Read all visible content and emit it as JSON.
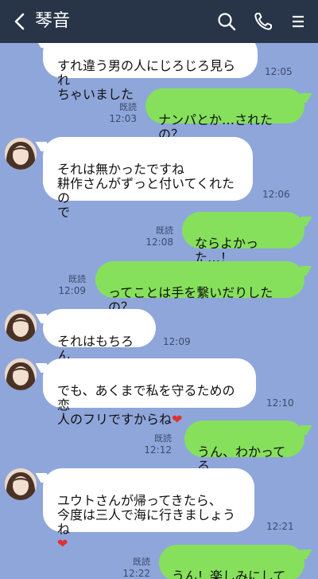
{
  "header": {
    "title": "琴音",
    "back_icon": "chevron-left-icon",
    "search_icon": "search-icon",
    "call_icon": "phone-icon",
    "menu_icon": "menu-icon"
  },
  "messages": [
    {
      "from": "them",
      "text": "すれ違う男の人にじろじろ見られ\nちゃいました",
      "time": "12:05"
    },
    {
      "from": "me",
      "text": "ナンパとか…されたの？",
      "read": "既読",
      "time": "12:03"
    },
    {
      "from": "them",
      "text": "それは無かったですね\n耕作さんがずっと付いてくれたの\nで",
      "time": "12:06"
    },
    {
      "from": "me",
      "text": "ならよかった…！",
      "read": "既読",
      "time": "12:08"
    },
    {
      "from": "me",
      "text": "ってことは手を繋いだりしたの？",
      "read": "既読",
      "time": "12:09"
    },
    {
      "from": "them",
      "text": "それはもちろん",
      "time": "12:09"
    },
    {
      "from": "them",
      "text": "でも、あくまで私を守るための恋\n人のフリですからね",
      "emoji": "❤",
      "time": "12:10"
    },
    {
      "from": "me",
      "text": "うん、わかってる",
      "read": "既読",
      "time": "12:12"
    },
    {
      "from": "them",
      "text": "ユウトさんが帰ってきたら、\n今度は三人で海に行きましょうね\n",
      "emoji": "❤",
      "time": "12:21"
    },
    {
      "from": "me",
      "text": "うん！楽しみにしてる",
      "read": "既読",
      "time": "12:22"
    }
  ],
  "colors": {
    "background": "#8fa6da",
    "header": "#283548",
    "bubble_in": "#ffffff",
    "bubble_out": "#86e05c"
  }
}
